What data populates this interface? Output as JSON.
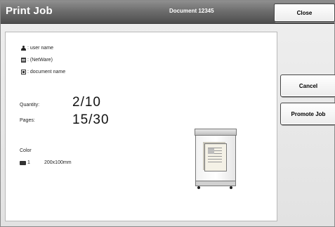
{
  "header": {
    "title": "Print Job",
    "document_title": "Document 12345",
    "close_label": "Close"
  },
  "job_info": {
    "user": ": user name",
    "network": ": (NetWare)",
    "document": ": document name"
  },
  "quantity": {
    "label": "Quantity:",
    "value": "2/10"
  },
  "pages": {
    "label": "Pages:",
    "value": "15/30"
  },
  "color": {
    "label": "Color"
  },
  "paper_tray": {
    "number": "1",
    "size": "200x100mm"
  },
  "actions": {
    "cancel_label": "Cancel",
    "promote_label": "Promote Job"
  },
  "colors": {
    "header_gradient_top": "#8f8f8f",
    "header_gradient_bottom": "#4e4e4e",
    "panel_bg": "#ffffff",
    "background": "#e6e6e6"
  },
  "icons": {
    "user": "person-icon",
    "network": "network-icon",
    "document": "document-icon",
    "tray": "paper-tray-icon",
    "printer": "printer-illustration"
  }
}
